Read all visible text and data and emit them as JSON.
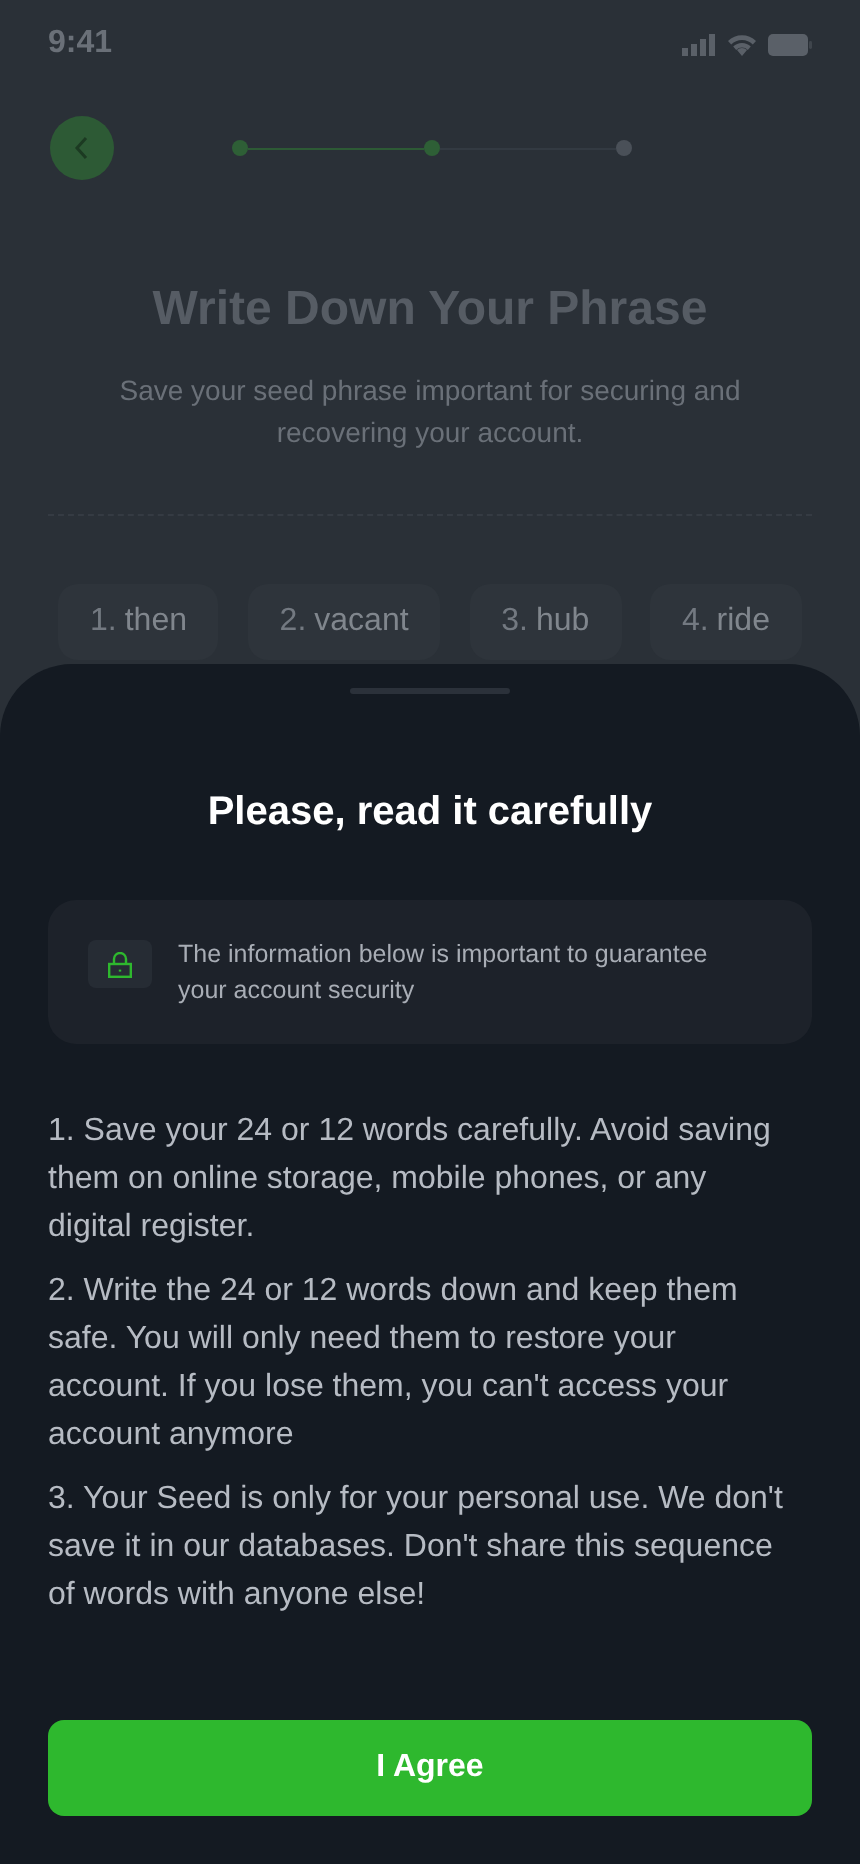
{
  "status_bar": {
    "time": "9:41"
  },
  "steps": [
    {
      "done": true
    },
    {
      "done": true
    },
    {
      "done": false
    }
  ],
  "page": {
    "title": "Write Down Your Phrase",
    "subtitle": "Save your seed phrase important for securing and recovering your account."
  },
  "words": [
    {
      "number": "1.",
      "word": "then"
    },
    {
      "number": "2.",
      "word": "vacant"
    },
    {
      "number": "3.",
      "word": "hub"
    },
    {
      "number": "4.",
      "word": "ride"
    }
  ],
  "sheet": {
    "title": "Please, read it carefully",
    "notice": "The information below is important to guarantee your account security",
    "points": [
      "1. Save your 24 or 12 words carefully. Avoid saving them on online storage, mobile phones, or any digital register.",
      "2. Write the 24 or 12 words down and keep them safe. You will only need them to restore your account. If you lose them, you can't access your account anymore",
      "3. Your Seed is only for your personal use. We don't save it in our databases. Don't share this sequence of words with anyone else!"
    ],
    "button": "I Agree"
  }
}
